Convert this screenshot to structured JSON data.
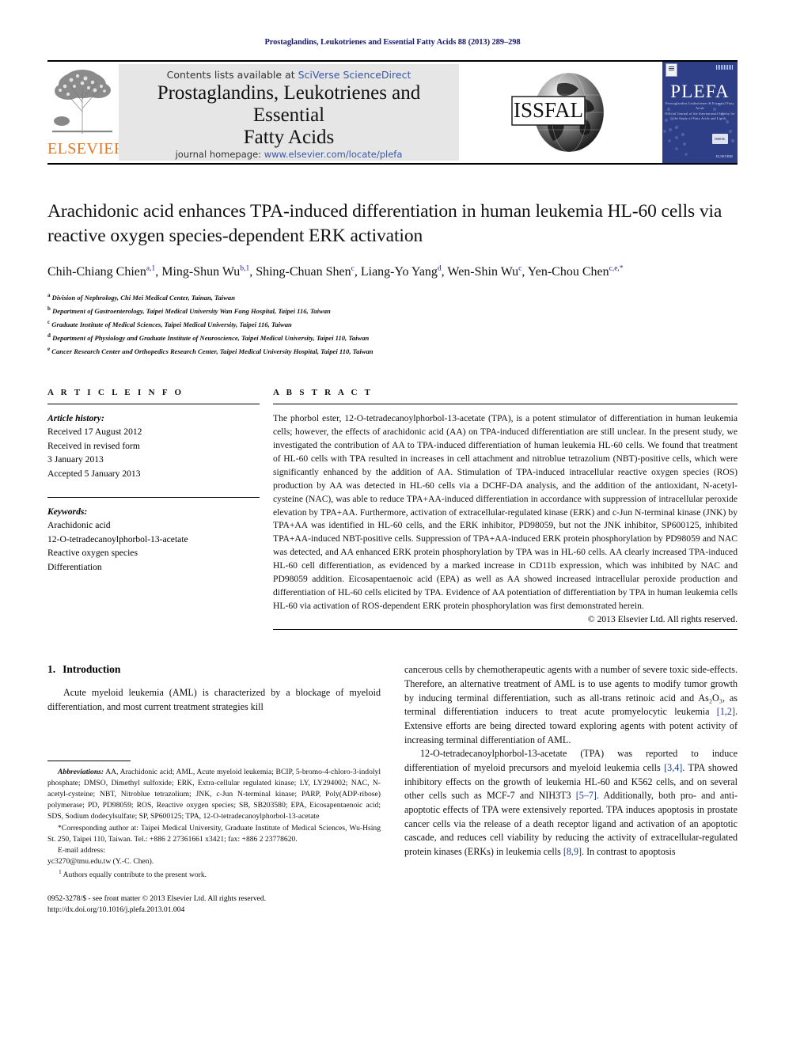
{
  "running_head": "Prostaglandins, Leukotrienes and Essential Fatty Acids 88 (2013) 289–298",
  "masthead": {
    "elsevier_wordmark": "ELSEVIER",
    "contents_prefix": "Contents lists available at ",
    "contents_link": "SciVerse ScienceDirect",
    "journal_title_line1": "Prostaglandins, Leukotrienes and Essential",
    "journal_title_line2": "Fatty Acids",
    "homepage_prefix": "journal homepage: ",
    "homepage_url": "www.elsevier.com/locate/plefa",
    "issfal_logo_text": "ISSFAL",
    "cover": {
      "title": "PLEFA",
      "subtitle_line1": "Prostaglandins Leukotrienes & Essential Fatty Acids",
      "subtitle_line2": "Official Journal of the International Society for the Study of Fatty Acids and Lipids",
      "badge": "ISSFAL",
      "publisher": "ELSEVIER"
    },
    "link_color": "#3a57a8",
    "elsevier_orange": "#E87722",
    "cover_blue": "#2e3f87"
  },
  "article": {
    "title": "Arachidonic acid enhances TPA-induced differentiation in human leukemia HL-60 cells via reactive oxygen species-dependent ERK activation",
    "authors_html": "Chih-Chiang Chien<sup>a,1</sup>, Ming-Shun Wu<sup>b,1</sup>, Shing-Chuan Shen<sup>c</sup>, Liang-Yo Yang<sup>d</sup>, Wen-Shin Wu<sup>c</sup>, Yen-Chou Chen<sup>c,e,</sup><sup>*</sup>",
    "affiliations": [
      {
        "marker": "a",
        "text": "Division of Nephrology, Chi Mei Medical Center, Tainan, Taiwan"
      },
      {
        "marker": "b",
        "text": "Department of Gastroenterology, Taipei Medical University Wan Fang Hospital, Taipei 116, Taiwan"
      },
      {
        "marker": "c",
        "text": "Graduate Institute of Medical Sciences, Taipei Medical University, Taipei 116, Taiwan"
      },
      {
        "marker": "d",
        "text": "Department of Physiology and Graduate Institute of Neuroscience, Taipei Medical University, Taipei 110, Taiwan"
      },
      {
        "marker": "e",
        "text": "Cancer Research Center and Orthopedics Research Center, Taipei Medical University Hospital, Taipei 110, Taiwan"
      }
    ]
  },
  "article_info": {
    "heading": "A R T I C L E   I N F O",
    "history_label": "Article history:",
    "history_lines": [
      "Received 17 August 2012",
      "Received in revised form",
      "3 January 2013",
      "Accepted 5 January 2013"
    ],
    "keywords_label": "Keywords:",
    "keywords": [
      "Arachidonic acid",
      "12-O-tetradecanoylphorbol-13-acetate",
      "Reactive oxygen species",
      "Differentiation"
    ]
  },
  "abstract": {
    "heading": "A B S T R A C T",
    "text": "The phorbol ester, 12-O-tetradecanoylphorbol-13-acetate (TPA), is a potent stimulator of differentiation in human leukemia cells; however, the effects of arachidonic acid (AA) on TPA-induced differentiation are still unclear. In the present study, we investigated the contribution of AA to TPA-induced differentiation of human leukemia HL-60 cells. We found that treatment of HL-60 cells with TPA resulted in increases in cell attachment and nitroblue tetrazolium (NBT)-positive cells, which were significantly enhanced by the addition of AA. Stimulation of TPA-induced intracellular reactive oxygen species (ROS) production by AA was detected in HL-60 cells via a DCHF-DA analysis, and the addition of the antioxidant, N-acetyl-cysteine (NAC), was able to reduce TPA+AA-induced differentiation in accordance with suppression of intracellular peroxide elevation by TPA+AA. Furthermore, activation of extracellular-regulated kinase (ERK) and c-Jun N-terminal kinase (JNK) by TPA+AA was identified in HL-60 cells, and the ERK inhibitor, PD98059, but not the JNK inhibitor, SP600125, inhibited TPA+AA-induced NBT-positive cells. Suppression of TPA+AA-induced ERK protein phosphorylation by PD98059 and NAC was detected, and AA enhanced ERK protein phosphorylation by TPA was in HL-60 cells. AA clearly increased TPA-induced HL-60 cell differentiation, as evidenced by a marked increase in CD11b expression, which was inhibited by NAC and PD98059 addition. Eicosapentaenoic acid (EPA) as well as AA showed increased intracellular peroxide production and differentiation of HL-60 cells elicited by TPA. Evidence of AA potentiation of differentiation by TPA in human leukemia cells HL-60 via activation of ROS-dependent ERK protein phosphorylation was first demonstrated herein.",
    "copyright": "© 2013 Elsevier Ltd. All rights reserved."
  },
  "introduction": {
    "number": "1.",
    "heading": "Introduction",
    "left_paragraph": "Acute myeloid leukemia (AML) is characterized by a blockage of myeloid differentiation, and most current treatment strategies kill",
    "right_paragraph_1": "cancerous cells by chemotherapeutic agents with a number of severe toxic side-effects. Therefore, an alternative treatment of AML is to use agents to modify tumor growth by inducing terminal differentiation, such as all-trans retinoic acid and As₂O₃, as terminal differentiation inducers to treat acute promyelocytic leukemia [1,2]. Extensive efforts are being directed toward exploring agents with potent activity of increasing terminal differentiation of AML.",
    "right_paragraph_2": "12-O-tetradecanoylphorbol-13-acetate (TPA) was reported to induce differentiation of myeloid precursors and myeloid leukemia cells [3,4]. TPA showed inhibitory effects on the growth of leukemia HL-60 and K562 cells, and on several other cells such as MCF-7 and NIH3T3 [5–7]. Additionally, both pro- and anti-apoptotic effects of TPA were extensively reported. TPA induces apoptosis in prostate cancer cells via the release of a death receptor ligand and activation of an apoptotic cascade, and reduces cell viability by reducing the activity of extracellular-regulated protein kinases (ERKs) in leukemia cells [8,9]. In contrast to apoptosis"
  },
  "footnotes": {
    "abbreviations_label": "Abbreviations:",
    "abbreviations_text": " AA, Arachidonic acid; AML, Acute myeloid leukemia; BCIP, 5-bromo-4-chloro-3-indolyl phosphate; DMSO, Dimethyl sulfoxide; ERK, Extra-cellular regulated kinase; LY, LY294002; NAC, N-acetyl-cysteine; NBT, Nitroblue tetrazolium; JNK, c-Jun N-terminal kinase; PARP, Poly(ADP-ribose) polymerase; PD, PD98059; ROS, Reactive oxygen species; SB, SB203580; EPA, Eicosapentaenoic acid; SDS, Sodium dodecylsulfate; SP, SP600125; TPA, 12-O-tetradecanoylphorbol-13-acetate",
    "corresponding_author": "Corresponding author at: Taipei Medical University, Graduate Institute of Medical Sciences, Wu-Hsing St. 250, Taipei 110, Taiwan. Tel.: +886 2 27361661 x3421; fax: +886 2 23778620.",
    "email_label": "E-mail address:",
    "email_text": "yc3270@tmu.edu.tw (Y.-C. Chen).",
    "equal_contribution": "Authors equally contribute to the present work.",
    "equal_marker": "1"
  },
  "imprint": {
    "line1": "0952-3278/$ - see front matter © 2013 Elsevier Ltd. All rights reserved.",
    "line2": "http://dx.doi.org/10.1016/j.plefa.2013.01.004"
  }
}
